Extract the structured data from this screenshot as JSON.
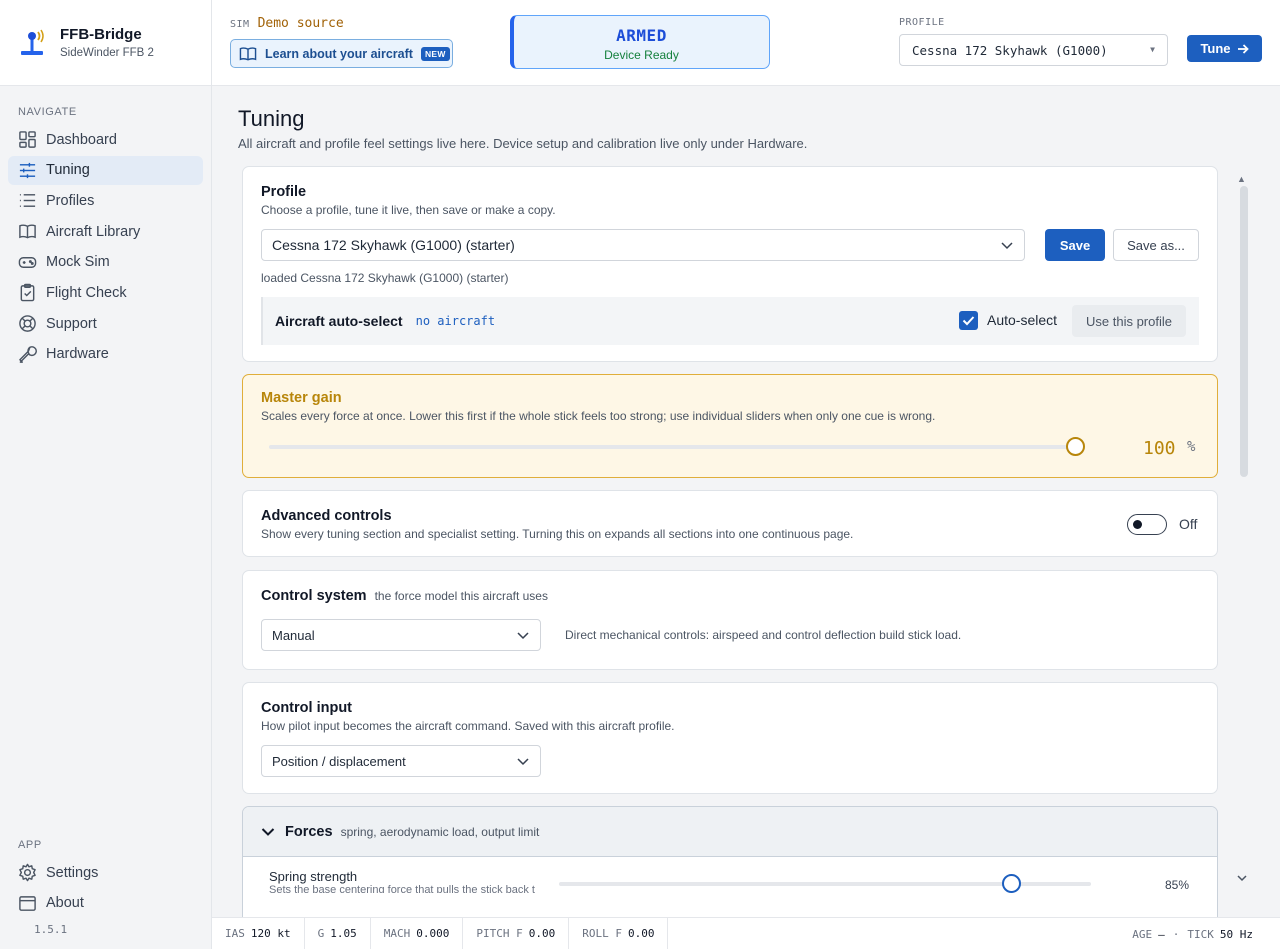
{
  "brand": {
    "title": "FFB-Bridge",
    "subtitle": "SideWinder FFB 2"
  },
  "nav": {
    "heading": "NAVIGATE",
    "items": [
      {
        "label": "Dashboard",
        "icon": "dashboard-grid-icon"
      },
      {
        "label": "Tuning",
        "icon": "sliders-icon",
        "active": true
      },
      {
        "label": "Profiles",
        "icon": "list-icon"
      },
      {
        "label": "Aircraft Library",
        "icon": "book-icon"
      },
      {
        "label": "Mock Sim",
        "icon": "gamepad-icon"
      },
      {
        "label": "Flight Check",
        "icon": "clipboard-check-icon"
      },
      {
        "label": "Support",
        "icon": "lifebuoy-icon"
      },
      {
        "label": "Hardware",
        "icon": "wrench-icon"
      }
    ]
  },
  "app_nav": {
    "heading": "APP",
    "items": [
      {
        "label": "Settings",
        "icon": "gear-icon"
      },
      {
        "label": "About",
        "icon": "window-icon"
      }
    ],
    "version": "1.5.1"
  },
  "topbar": {
    "sim_label": "SIM",
    "sim_value": "Demo source",
    "learn_label": "Learn about your aircraft",
    "learn_badge": "NEW",
    "status_title": "ARMED",
    "status_sub": "Device Ready",
    "profile_label": "PROFILE",
    "profile_value": "Cessna 172 Skyhawk (G1000)",
    "tune_label": "Tune"
  },
  "page": {
    "title": "Tuning",
    "description": "All aircraft and profile feel settings live here. Device setup and calibration live only under Hardware."
  },
  "profile_card": {
    "title": "Profile",
    "subtitle": "Choose a profile, tune it live, then save or make a copy.",
    "selected": "Cessna 172 Skyhawk (G1000) (starter)",
    "save_label": "Save",
    "save_as_label": "Save as...",
    "loaded_text": "loaded Cessna 172 Skyhawk (G1000) (starter)",
    "auto_title": "Aircraft auto-select",
    "auto_value": "no aircraft",
    "auto_checkbox_label": "Auto-select",
    "auto_checked": true,
    "use_label": "Use this profile"
  },
  "master_gain": {
    "title": "Master gain",
    "description": "Scales every force at once. Lower this first if the whole stick feels too strong; use individual sliders when only one cue is wrong.",
    "value": "100",
    "unit": "%",
    "level": 1.0
  },
  "advanced": {
    "title": "Advanced controls",
    "description": "Show every tuning section and specialist setting. Turning this on expands all sections into one continuous page.",
    "state_label": "Off"
  },
  "control_system": {
    "title": "Control system",
    "inline_sub": "the force model this aircraft uses",
    "selected": "Manual",
    "description": "Direct mechanical controls: airspeed and control deflection build stick load."
  },
  "control_input": {
    "title": "Control input",
    "subtitle": "How pilot input becomes the aircraft command. Saved with this aircraft profile.",
    "selected": "Position / displacement"
  },
  "forces": {
    "title": "Forces",
    "subtitle": "spring, aerodynamic load, output limit",
    "spring_label": "Spring strength",
    "spring_desc": "Sets the base centering force that pulls the stick back t",
    "spring_value": "85%",
    "spring_level": 0.85
  },
  "statusbar": {
    "items": [
      {
        "k": "IAS",
        "v": "120 kt"
      },
      {
        "k": "G",
        "v": "1.05"
      },
      {
        "k": "MACH",
        "v": "0.000"
      },
      {
        "k": "PITCH F",
        "v": "0.00"
      },
      {
        "k": "ROLL F",
        "v": "0.00"
      }
    ],
    "age_k": "AGE",
    "age_v": "—",
    "sep": "·",
    "tick_k": "TICK",
    "tick_v": "50 Hz"
  },
  "colors": {
    "accent": "#1d5fbf",
    "gain": "#b8860b",
    "gain_bg": "#fef7e6",
    "ok": "#15803d"
  }
}
